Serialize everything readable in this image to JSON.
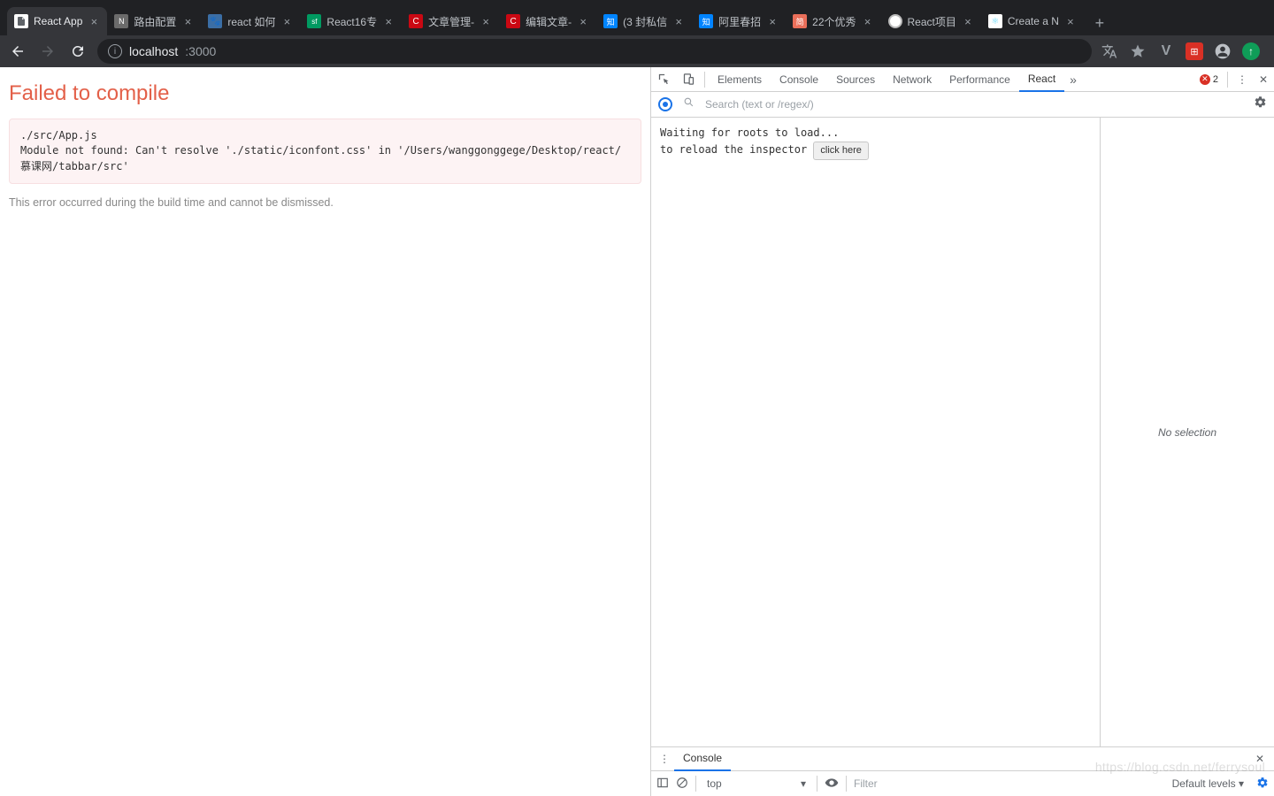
{
  "browser": {
    "tabs": [
      {
        "title": "React App",
        "icon": "doc",
        "bg": "#fff",
        "active": true
      },
      {
        "title": "路由配置",
        "icon": "N",
        "bg": "#5a5a5a"
      },
      {
        "title": "react 如何",
        "icon": "paw",
        "bg": "#3b6ea5"
      },
      {
        "title": "React16专",
        "icon": "sf",
        "bg": "#009a61"
      },
      {
        "title": "文章管理-",
        "icon": "C",
        "bg": "#ca0813"
      },
      {
        "title": "编辑文章-",
        "icon": "C",
        "bg": "#ca0813"
      },
      {
        "title": "(3 封私信",
        "icon": "知",
        "bg": "#0084ff"
      },
      {
        "title": "阿里春招",
        "icon": "知",
        "bg": "#0084ff"
      },
      {
        "title": "22个优秀",
        "icon": "简",
        "bg": "#ea6f5a"
      },
      {
        "title": "React项目",
        "icon": "ring",
        "bg": "#fff"
      },
      {
        "title": "Create a N",
        "icon": "atom",
        "bg": "#fff"
      }
    ],
    "url_host": "localhost",
    "url_port": ":3000"
  },
  "page": {
    "heading": "Failed to compile",
    "code_line1": "./src/App.js",
    "code_line2": "Module not found: Can't resolve './static/iconfont.css' in '/Users/wanggonggege/Desktop/react/慕课网/tabbar/src'",
    "note": "This error occurred during the build time and cannot be dismissed."
  },
  "devtools": {
    "tabs": [
      "Elements",
      "Console",
      "Sources",
      "Network",
      "Performance",
      "React"
    ],
    "active_tab": "React",
    "error_count": "2",
    "search_placeholder": "Search (text or /regex/)",
    "tree_line1": "Waiting for roots to load...",
    "tree_line2_pre": "to reload the inspector ",
    "tree_button": "click here",
    "side_label": "No selection",
    "drawer_tab": "Console",
    "context": "top",
    "filter_placeholder": "Filter",
    "levels": "Default levels ▾"
  },
  "watermark": "https://blog.csdn.net/ferrysoul"
}
